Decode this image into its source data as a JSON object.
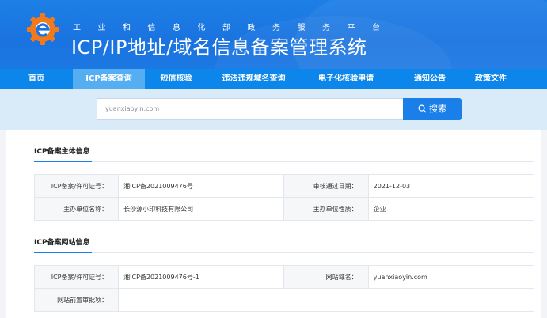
{
  "header": {
    "subtitle": "工业和信息化部政务服务平台",
    "title": "ICP/IP地址/域名信息备案管理系统"
  },
  "nav": {
    "items": [
      {
        "label": "首页"
      },
      {
        "label": "ICP备案查询",
        "active": true
      },
      {
        "label": "短信核验"
      },
      {
        "label": "违法违规域名查询"
      },
      {
        "label": "电子化核验申请"
      },
      {
        "label": "通知公告"
      },
      {
        "label": "政策文件"
      }
    ]
  },
  "search": {
    "value": "yuanxiaoyin.com",
    "button_label": "搜索"
  },
  "subject": {
    "title": "ICP备案主体信息",
    "rows": [
      {
        "label1": "ICP备案/许可证号：",
        "value1": "湘ICP备2021009476号",
        "label2": "审核通过日期：",
        "value2": "2021-12-03"
      },
      {
        "label1": "主办单位名称：",
        "value1": "长沙源小印科技有限公司",
        "label2": "主办单位性质：",
        "value2": "企业"
      }
    ]
  },
  "website": {
    "title": "ICP备案网站信息",
    "rows": [
      {
        "label1": "ICP备案/许可证号：",
        "value1": "湘ICP备2021009476号-1",
        "label2": "网站域名：",
        "value2": "yuanxiaoyin.com"
      },
      {
        "label1": "网站前置审批项：",
        "value1": "",
        "label2": "",
        "value2": ""
      }
    ]
  },
  "colors": {
    "header": "#1a73e0",
    "nav": "#0c86ea",
    "nav_active": "#56aef2",
    "search_band": "#d9ebf9",
    "accent": "#1a7fe8"
  }
}
